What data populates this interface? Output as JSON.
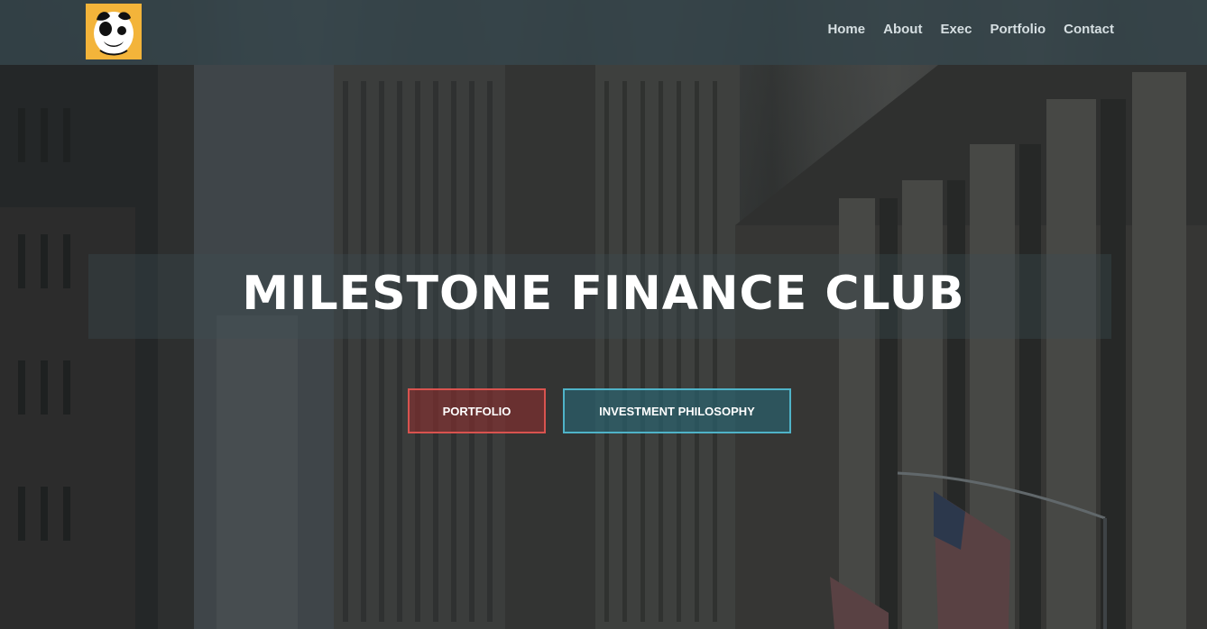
{
  "navbar": {
    "links": [
      {
        "label": "Home"
      },
      {
        "label": "About"
      },
      {
        "label": "Exec"
      },
      {
        "label": "Portfolio"
      },
      {
        "label": "Contact"
      }
    ]
  },
  "hero": {
    "title": "MILESTONE FINANCE CLUB",
    "buttons": {
      "portfolio_label": "PORTFOLIO",
      "philosophy_label": "INVESTMENT PHILOSOPHY"
    }
  },
  "colors": {
    "navbar_bg": "#34444a",
    "logo_bg": "#f3b43a",
    "portfolio_border": "#d9534f",
    "philosophy_border": "#4fb3c8"
  },
  "icons": {
    "logo": "bulldog-logo"
  }
}
